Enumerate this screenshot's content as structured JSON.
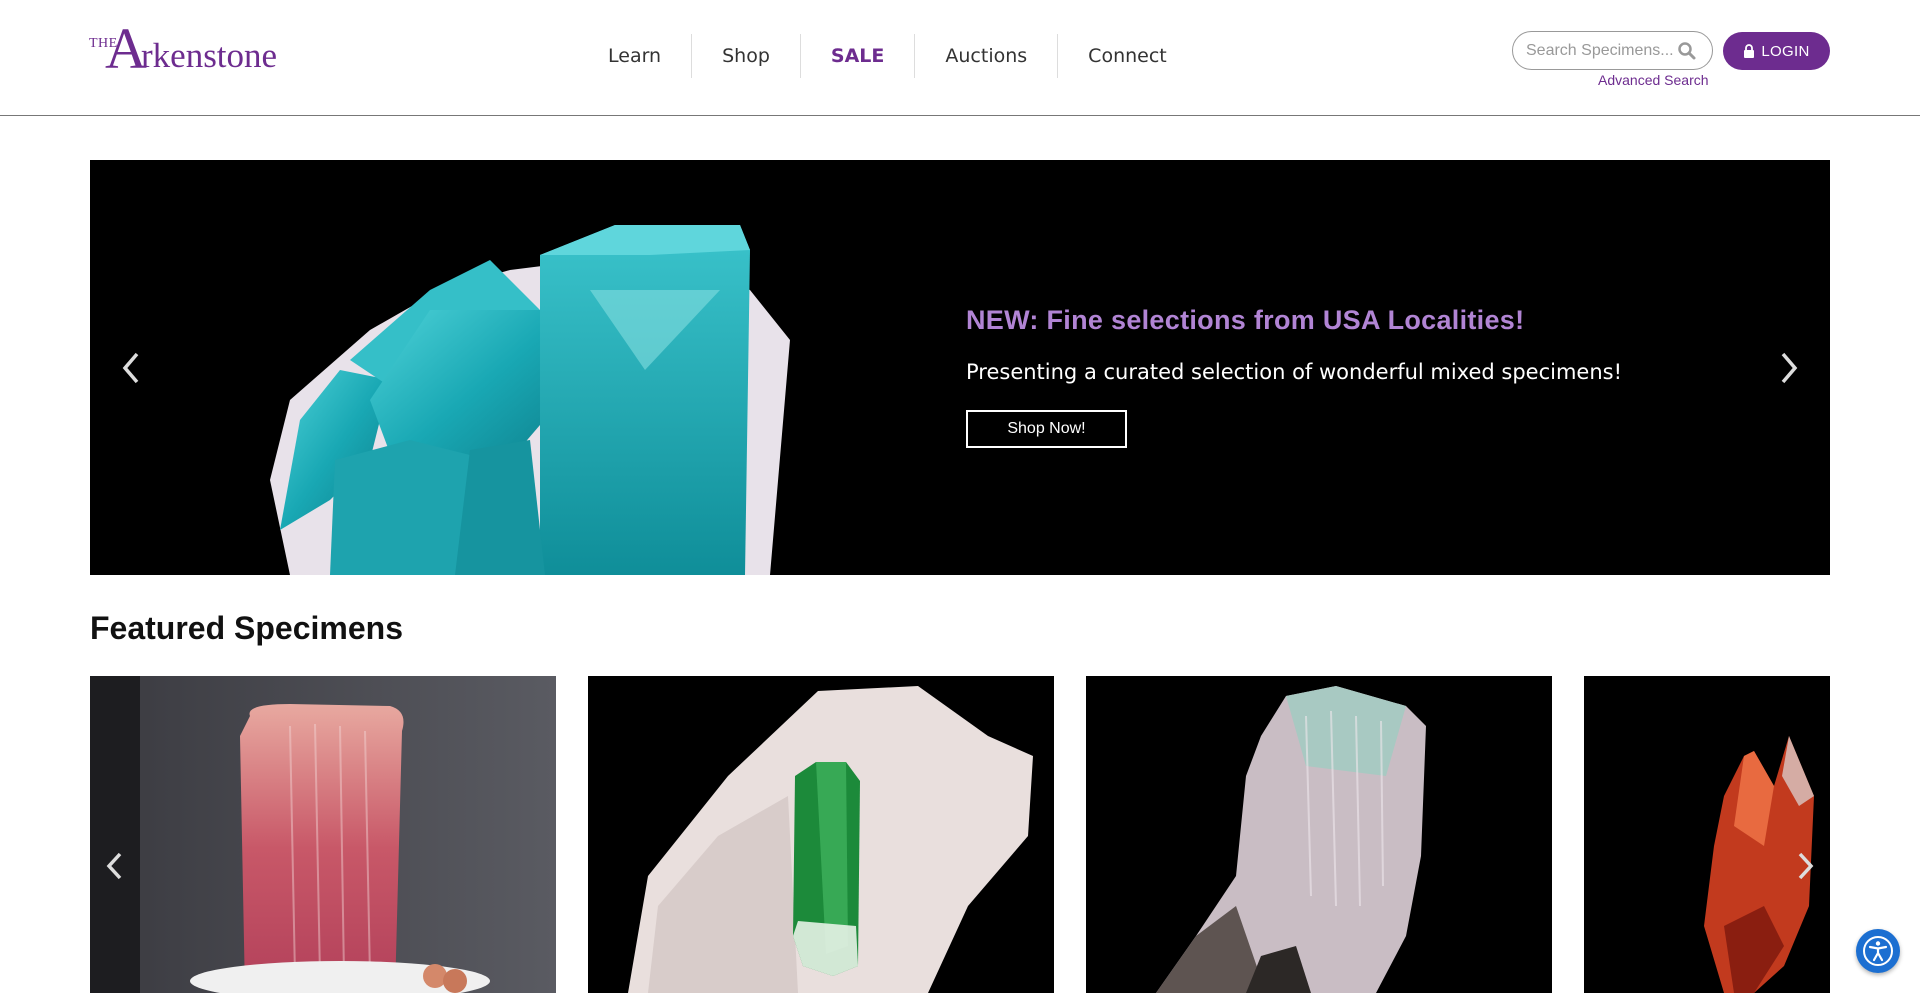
{
  "brand": {
    "the": "THE",
    "initial": "A",
    "rest": "rkenstone",
    "color": "#6d2c8f"
  },
  "nav": {
    "items": [
      {
        "label": "Learn"
      },
      {
        "label": "Shop"
      },
      {
        "label": "SALE"
      },
      {
        "label": "Auctions"
      },
      {
        "label": "Connect"
      }
    ]
  },
  "search": {
    "placeholder": "Search Specimens...",
    "value": "",
    "icon": "search-icon",
    "advanced_label": "Advanced Search"
  },
  "login": {
    "label": "LOGIN",
    "icon": "lock-icon"
  },
  "hero": {
    "title": "NEW: Fine selections from USA Localities!",
    "subtitle": "Presenting a curated selection of wonderful mixed specimens!",
    "button_label": "Shop Now!",
    "title_color": "#b184d4",
    "prev_icon": "chevron-left-icon",
    "next_icon": "chevron-right-icon"
  },
  "featured": {
    "title": "Featured Specimens",
    "prev_icon": "chevron-left-icon",
    "next_icon": "chevron-right-icon"
  },
  "accessibility": {
    "icon": "accessibility-icon",
    "color": "#1c6fd1"
  }
}
